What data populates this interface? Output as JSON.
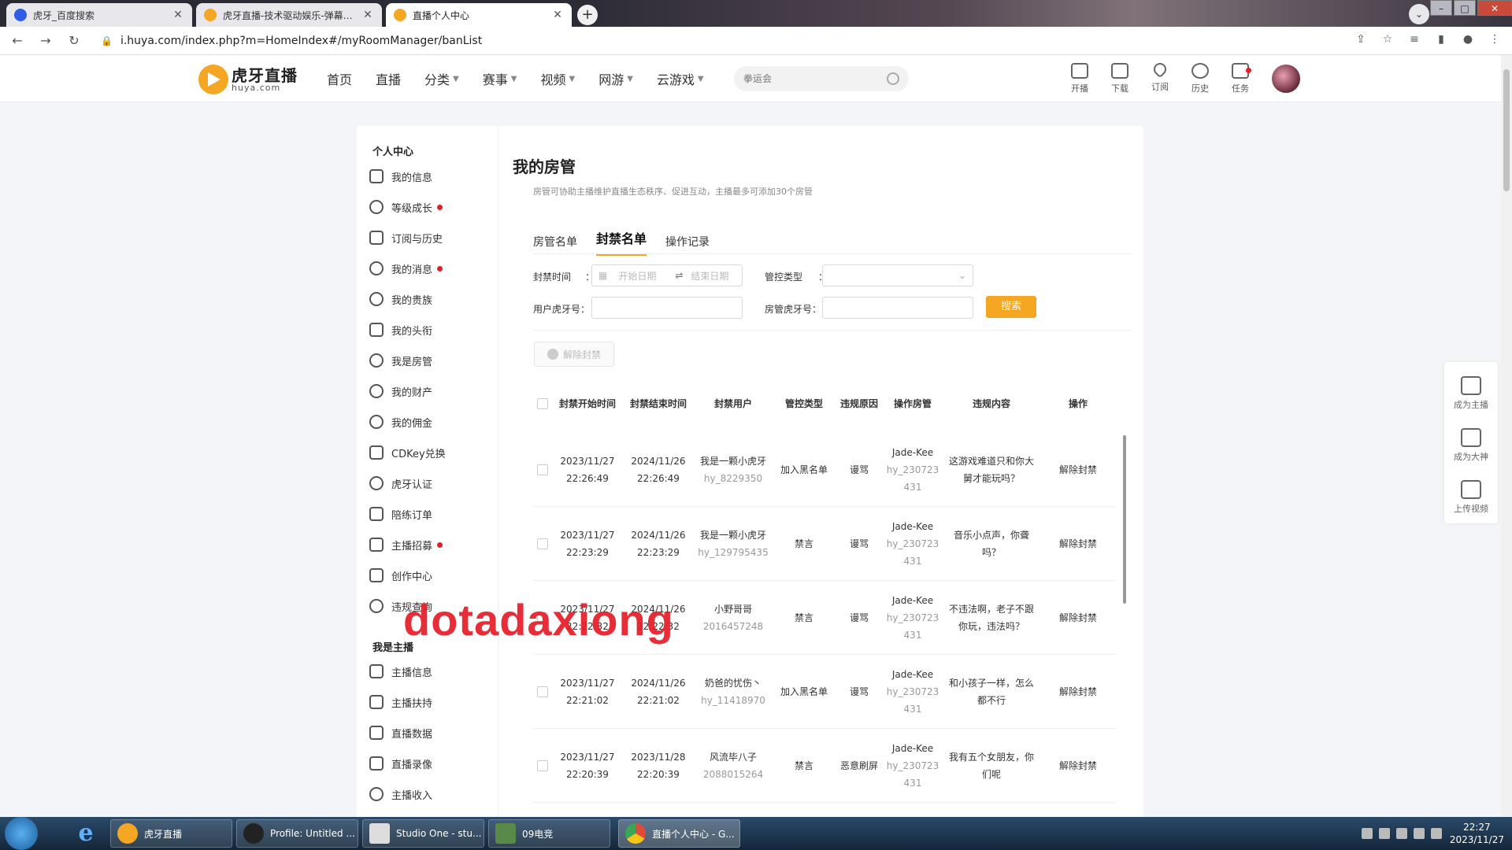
{
  "browser": {
    "tabs": [
      {
        "title": "虎牙_百度搜索",
        "icon": "baidu-icon"
      },
      {
        "title": "虎牙直播-技术驱动娱乐-弹幕式互",
        "icon": "huya-icon"
      },
      {
        "title": "直播个人中心",
        "icon": "huya-icon"
      }
    ],
    "url": "i.huya.com/index.php?m=HomeIndex#/myRoomManager/banList"
  },
  "header": {
    "logo_cn": "虎牙直播",
    "logo_en": "huya.com",
    "nav": [
      "首页",
      "直播",
      "分类",
      "赛事",
      "视频",
      "网游",
      "云游戏"
    ],
    "search_placeholder": "拳运会",
    "icons": [
      "开播",
      "下载",
      "订阅",
      "历史",
      "任务"
    ]
  },
  "sidebar": {
    "section1": "个人中心",
    "items1": [
      "我的信息",
      "等级成长",
      "订阅与历史",
      "我的消息",
      "我的贵族",
      "我的头衔",
      "我是房管",
      "我的财产",
      "我的佣金",
      "CDKey兑换",
      "虎牙认证",
      "陪练订单",
      "主播招募",
      "创作中心",
      "违规查询"
    ],
    "section2": "我是主播",
    "items2": [
      "主播信息",
      "主播扶持",
      "直播数据",
      "直播录像",
      "主播收入"
    ]
  },
  "main": {
    "title": "我的房管",
    "desc": "房管可协助主播维护直播生态秩序、促进互动，主播最多可添加30个房管",
    "tabs": [
      "房管名单",
      "封禁名单",
      "操作记录"
    ],
    "filters": {
      "ban_time_label": "封禁时间",
      "start_placeholder": "开始日期",
      "end_placeholder": "结束日期",
      "type_label": "管控类型",
      "user_label": "用户虎牙号：",
      "manager_label": "房管虎牙号：",
      "search_btn": "搜索",
      "colon": "："
    },
    "unban_all": "解除封禁",
    "columns": [
      "封禁开始时间",
      "封禁结束时间",
      "封禁用户",
      "管控类型",
      "违规原因",
      "操作房管",
      "违规内容",
      "操作"
    ],
    "rows": [
      {
        "start_date": "2023/11/27",
        "start_time": "22:26:49",
        "end_date": "2024/11/26",
        "end_time": "22:26:49",
        "user": "我是一颗小虎牙",
        "uid": "hy_8229350",
        "type": "加入黑名单",
        "reason": "谩骂",
        "mgr": "Jade-Kee",
        "mgr_id": "hy_230723431",
        "content": "这游戏难道只和你大舅才能玩吗？",
        "action": "解除封禁"
      },
      {
        "start_date": "2023/11/27",
        "start_time": "22:23:29",
        "end_date": "2024/11/26",
        "end_time": "22:23:29",
        "user": "我是一颗小虎牙",
        "uid": "hy_129795435",
        "type": "禁言",
        "reason": "谩骂",
        "mgr": "Jade-Kee",
        "mgr_id": "hy_230723431",
        "content": "音乐小点声，你聋吗？",
        "action": "解除封禁"
      },
      {
        "start_date": "2023/11/27",
        "start_time": "22:22:32",
        "end_date": "2024/11/26",
        "end_time": "22:22:32",
        "user": "小野哥哥",
        "uid": "2016457248",
        "type": "禁言",
        "reason": "谩骂",
        "mgr": "Jade-Kee",
        "mgr_id": "hy_230723431",
        "content": "不违法啊，老子不跟你玩，违法吗？",
        "action": "解除封禁"
      },
      {
        "start_date": "2023/11/27",
        "start_time": "22:21:02",
        "end_date": "2024/11/26",
        "end_time": "22:21:02",
        "user": "奶爸的忧伤丶",
        "uid": "hy_11418970",
        "type": "加入黑名单",
        "reason": "谩骂",
        "mgr": "Jade-Kee",
        "mgr_id": "hy_230723431",
        "content": "和小孩子一样，怎么都不行",
        "action": "解除封禁"
      },
      {
        "start_date": "2023/11/27",
        "start_time": "22:20:39",
        "end_date": "2023/11/28",
        "end_time": "22:20:39",
        "user": "风流毕八子",
        "uid": "2088015264",
        "type": "禁言",
        "reason": "恶意刷屏",
        "mgr": "Jade-Kee",
        "mgr_id": "hy_230723431",
        "content": "我有五个女朋友，你们呢",
        "action": "解除封禁"
      }
    ]
  },
  "watermark": "dotadaxiong",
  "float_panel": [
    "成为主播",
    "成为大神",
    "上传视频"
  ],
  "taskbar": {
    "items": [
      "虎牙直播",
      "Profile: Untitled ...",
      "Studio One - stu...",
      "09电竞",
      "直播个人中心 - G..."
    ],
    "time": "22:27",
    "date": "2023/11/27"
  }
}
